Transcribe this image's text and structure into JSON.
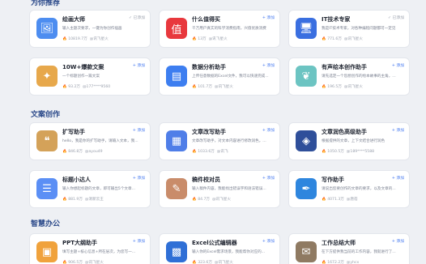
{
  "sections": [
    {
      "title": "为你推荐",
      "cards": [
        {
          "name": "绘画大师",
          "desc": "输入主题次要求，一键为你创作插画",
          "views": "10819.7万",
          "author": "@讯飞星火",
          "tag": "已添加",
          "added": true,
          "icon": "paint-icon",
          "icon_glyph": "🖼",
          "icon_bg": "#4d8df0"
        },
        {
          "name": "什么值得买",
          "desc": "千万用户真实的科学消费指南，兴值优质消费",
          "views": "13万",
          "author": "@讯飞星火",
          "tag": "添加",
          "added": false,
          "icon": "smzdm-logo-icon",
          "icon_glyph": "值",
          "icon_bg": "#e8383d"
        },
        {
          "name": "IT技术专家",
          "desc": "我是IT技术专家，对各种编程问题都可一定见",
          "views": "771.6万",
          "author": "@讯飞星火",
          "tag": "已添加",
          "added": true,
          "icon": "monitor-icon",
          "icon_glyph": "🖥",
          "icon_bg": "#3a6fe0"
        },
        {
          "name": "10W+爆款文案",
          "desc": "一个标题创作一篇文案",
          "views": "93.2万",
          "author": "@177****9560",
          "tag": "添加",
          "added": false,
          "icon": "art-icon",
          "icon_glyph": "✦",
          "icon_bg": "#e7a84b"
        },
        {
          "name": "数据分析助手",
          "desc": "上传任意数据的Excel文件，我可以快速完成...",
          "views": "101.7万",
          "author": "@讯飞星火",
          "tag": "添加",
          "added": false,
          "icon": "chart-icon",
          "icon_glyph": "▤",
          "icon_bg": "#3d7ef0"
        },
        {
          "name": "有声绘本创作助手",
          "desc": "请先选定一个您想创作的绘本故事的主角，...",
          "views": "196.5万",
          "author": "@讯飞星火",
          "tag": "添加",
          "added": false,
          "icon": "book-icon",
          "icon_glyph": "❦",
          "icon_bg": "#6cc4c2"
        }
      ]
    },
    {
      "title": "文案创作",
      "cards": [
        {
          "name": "扩写助手",
          "desc": "hello，我是你的扩写助手，请输入文本，我...",
          "views": "846.8万",
          "author": "@ayou49",
          "tag": "添加",
          "added": false,
          "icon": "expand-icon",
          "icon_glyph": "❝",
          "icon_bg": "#d4a259"
        },
        {
          "name": "文章改写助手",
          "desc": "文章改写助手，对文本内容进行修改润色，...",
          "views": "1033.6万",
          "author": "@讯飞",
          "tag": "添加",
          "added": false,
          "icon": "rewrite-icon",
          "icon_glyph": "▦",
          "icon_bg": "#4f7ee8"
        },
        {
          "name": "文章润色高级助手",
          "desc": "根据提供的文章，上下文结合进行润色",
          "views": "1050.5万",
          "author": "@189****5588",
          "tag": "添加",
          "added": false,
          "icon": "polish-icon",
          "icon_glyph": "◈",
          "icon_bg": "#2f4f9a"
        },
        {
          "name": "标题小达人",
          "desc": "输入你想起标题的文章，即可输出5个文章...",
          "views": "881.9万",
          "author": "@洞新云王",
          "tag": "添加",
          "added": false,
          "icon": "title-icon",
          "icon_glyph": "☰",
          "icon_bg": "#5b8ff5"
        },
        {
          "name": "稿件校对员",
          "desc": "输入稿件内容，我能找出错误字和语法错误...",
          "views": "84.7万",
          "author": "@讯飞星火",
          "tag": "添加",
          "added": false,
          "icon": "proofread-icon",
          "icon_glyph": "✎",
          "icon_bg": "#c98c6a"
        },
        {
          "name": "写作助手",
          "desc": "请说出您要创作的文章的要求，以及文章的...",
          "views": "4071.3万",
          "author": "@唐蓓",
          "tag": "添加",
          "added": false,
          "icon": "pen-icon",
          "icon_glyph": "✒",
          "icon_bg": "#2e86de"
        }
      ]
    },
    {
      "title": "智慧办公",
      "cards": [
        {
          "name": "PPT大纲助手",
          "desc": "填写主题+核心信息+所在层次，为您写一...",
          "views": "906.5万",
          "author": "@讯飞星火",
          "tag": "添加",
          "added": false,
          "icon": "ppt-icon",
          "icon_glyph": "▣",
          "icon_bg": "#f0a23c"
        },
        {
          "name": "Excel公式编辑器",
          "desc": "输入你的Excel需求场景，我能帮你对应的...",
          "views": "323.6万",
          "author": "@讯飞星火",
          "tag": "添加",
          "added": false,
          "icon": "excel-icon",
          "icon_glyph": "▩",
          "icon_bg": "#2f6fd6"
        },
        {
          "name": "工作总结大师",
          "desc": "在下方提供我当前的工作内容，我就进行了...",
          "views": "1672.2万",
          "author": "@yhcx",
          "tag": "添加",
          "added": false,
          "icon": "summary-icon",
          "icon_glyph": "✉",
          "icon_bg": "#8f7a62"
        }
      ]
    }
  ],
  "colors": {
    "accent": "#4a7cf0",
    "section_title": "#2c4a8a",
    "fire": "#f08a3c"
  }
}
